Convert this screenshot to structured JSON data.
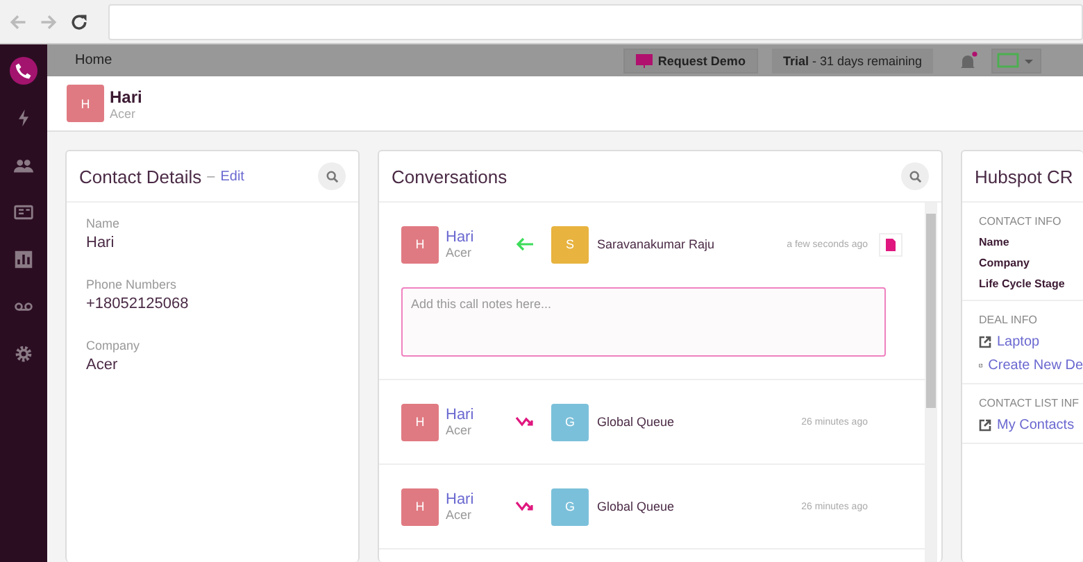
{
  "topbar": {
    "home": "Home",
    "demo_button": "Request Demo",
    "trial_label": "Trial",
    "trial_text": " - 31 days remaining",
    "notification_dot": true
  },
  "sidebar": {
    "items": [
      {
        "kind": "phone",
        "selected": true
      },
      {
        "kind": "bolt",
        "selected": false
      },
      {
        "kind": "people",
        "selected": false
      },
      {
        "kind": "card",
        "selected": false
      },
      {
        "kind": "chart",
        "selected": false
      },
      {
        "kind": "voicemail",
        "selected": false
      },
      {
        "kind": "gear",
        "selected": false
      }
    ]
  },
  "contact_header": {
    "initial": "H",
    "name": "Hari",
    "company": "Acer",
    "color": "#e07a82"
  },
  "contact_details": {
    "title": "Contact Details",
    "separator": "–",
    "edit": "Edit",
    "fields": [
      {
        "label": "Name",
        "value": "Hari"
      },
      {
        "label": "Phone Numbers",
        "value": "+18052125068"
      },
      {
        "label": "Company",
        "value": "Acer"
      }
    ]
  },
  "conversations": {
    "title": "Conversations",
    "items": [
      {
        "kind": "incoming",
        "contact": {
          "initial": "H",
          "name": "Hari",
          "company": "Acer",
          "color": "#e07a82"
        },
        "agent": {
          "initial": "S",
          "name": "Saravanakumar Raju",
          "color": "#e8b33f"
        },
        "time": "a few seconds ago",
        "has_document": true,
        "notes_placeholder": "Add this call notes here..."
      },
      {
        "kind": "forwarded",
        "contact": {
          "initial": "H",
          "name": "Hari",
          "company": "Acer",
          "color": "#e07a82"
        },
        "agent": {
          "initial": "G",
          "name": "Global Queue",
          "color": "#7bc0da"
        },
        "time": "26 minutes ago",
        "has_document": false
      },
      {
        "kind": "forwarded",
        "contact": {
          "initial": "H",
          "name": "Hari",
          "company": "Acer",
          "color": "#e07a82"
        },
        "agent": {
          "initial": "G",
          "name": "Global Queue",
          "color": "#7bc0da"
        },
        "time": "26 minutes ago",
        "has_document": false
      }
    ]
  },
  "crm": {
    "title": "Hubspot CR",
    "sections": [
      {
        "heading": "CONTACT INFO",
        "kind": "fields",
        "items": [
          "Name",
          "Company",
          "Life Cycle Stage"
        ]
      },
      {
        "heading": "DEAL INFO",
        "kind": "links",
        "items": [
          "Laptop",
          "Create New De"
        ]
      },
      {
        "heading": "CONTACT LIST INF",
        "kind": "links",
        "items": [
          "My Contacts"
        ]
      }
    ]
  }
}
